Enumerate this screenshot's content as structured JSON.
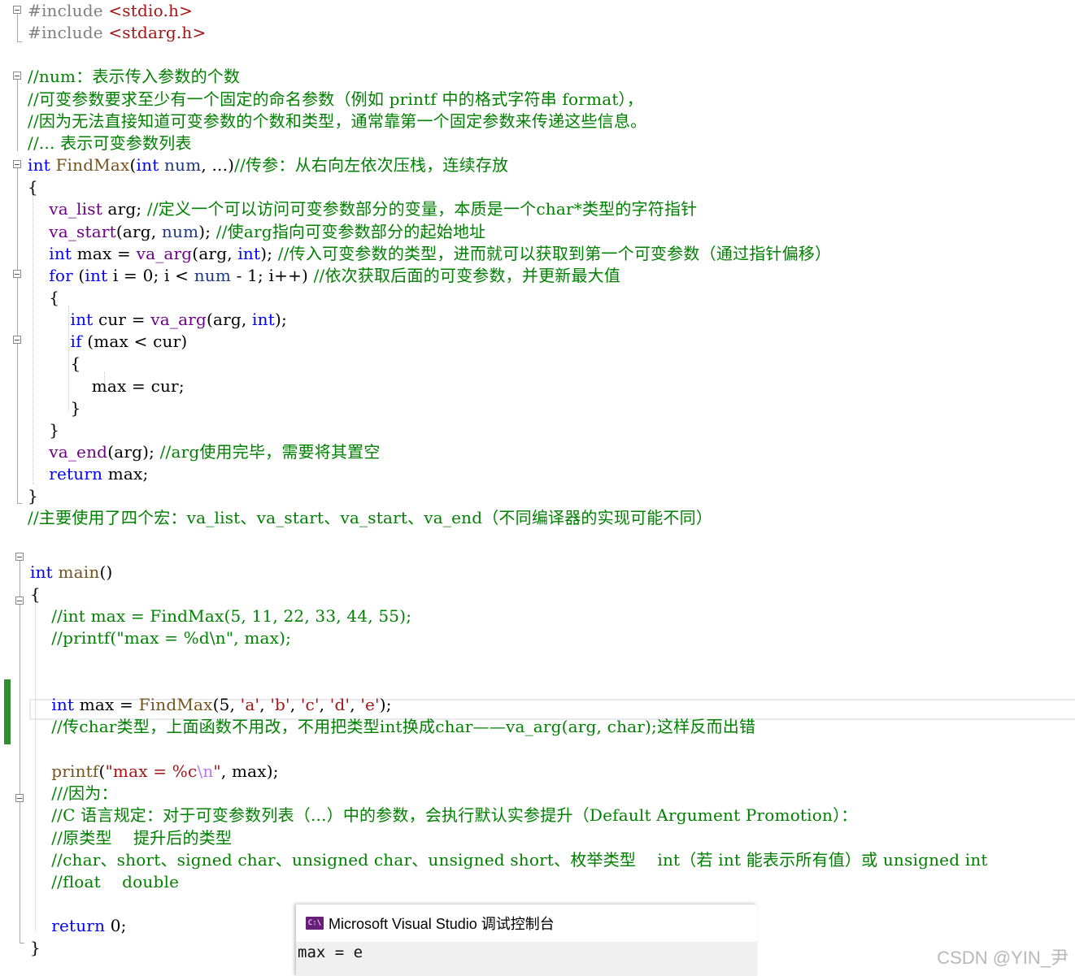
{
  "editor": {
    "lines": [
      {
        "tokens": [
          {
            "t": "#include ",
            "c": "pre"
          },
          {
            "t": "<stdio.h>",
            "c": "str"
          }
        ]
      },
      {
        "tokens": [
          {
            "t": "#include ",
            "c": "pre"
          },
          {
            "t": "<stdarg.h>",
            "c": "str"
          }
        ]
      },
      {
        "tokens": []
      },
      {
        "tokens": [
          {
            "t": "//num：表示传入参数的个数",
            "c": "cm"
          }
        ]
      },
      {
        "tokens": [
          {
            "t": "//可变参数要求至少有一个固定的命名参数（例如 printf 中的格式字符串 format），",
            "c": "cm"
          }
        ]
      },
      {
        "tokens": [
          {
            "t": "//因为无法直接知道可变参数的个数和类型，通常靠第一个固定参数来传递这些信息。",
            "c": "cm"
          }
        ]
      },
      {
        "tokens": [
          {
            "t": "//... 表示可变参数列表",
            "c": "cm"
          }
        ]
      },
      {
        "tokens": [
          {
            "t": "int",
            "c": "kw"
          },
          {
            "t": " ",
            "c": "pl"
          },
          {
            "t": "FindMax",
            "c": "fn"
          },
          {
            "t": "(",
            "c": "pl"
          },
          {
            "t": "int",
            "c": "kw"
          },
          {
            "t": " ",
            "c": "pl"
          },
          {
            "t": "num",
            "c": "var"
          },
          {
            "t": ", ...)",
            "c": "pl"
          },
          {
            "t": "//传参：从右向左依次压栈，连续存放",
            "c": "cm"
          }
        ]
      },
      {
        "tokens": [
          {
            "t": "{",
            "c": "pl"
          }
        ]
      },
      {
        "tokens": [
          {
            "t": "    ",
            "c": "pl"
          },
          {
            "t": "va_list",
            "c": "macro"
          },
          {
            "t": " ",
            "c": "pl"
          },
          {
            "t": "arg",
            "c": "id"
          },
          {
            "t": "; ",
            "c": "pl"
          },
          {
            "t": "//定义一个可以访问可变参数部分的变量，本质是一个char*类型的字符指针",
            "c": "cm"
          }
        ]
      },
      {
        "tokens": [
          {
            "t": "    ",
            "c": "pl"
          },
          {
            "t": "va_start",
            "c": "macro"
          },
          {
            "t": "(",
            "c": "pl"
          },
          {
            "t": "arg",
            "c": "id"
          },
          {
            "t": ", ",
            "c": "pl"
          },
          {
            "t": "num",
            "c": "var"
          },
          {
            "t": "); ",
            "c": "pl"
          },
          {
            "t": "//使arg指向可变参数部分的起始地址",
            "c": "cm"
          }
        ]
      },
      {
        "tokens": [
          {
            "t": "    ",
            "c": "pl"
          },
          {
            "t": "int",
            "c": "kw"
          },
          {
            "t": " ",
            "c": "pl"
          },
          {
            "t": "max",
            "c": "id"
          },
          {
            "t": " = ",
            "c": "pl"
          },
          {
            "t": "va_arg",
            "c": "macro"
          },
          {
            "t": "(",
            "c": "pl"
          },
          {
            "t": "arg",
            "c": "id"
          },
          {
            "t": ", ",
            "c": "pl"
          },
          {
            "t": "int",
            "c": "kw"
          },
          {
            "t": "); ",
            "c": "pl"
          },
          {
            "t": "//传入可变参数的类型，进而就可以获取到第一个可变参数（通过指针偏移）",
            "c": "cm"
          }
        ]
      },
      {
        "tokens": [
          {
            "t": "    ",
            "c": "pl"
          },
          {
            "t": "for",
            "c": "kw"
          },
          {
            "t": " (",
            "c": "pl"
          },
          {
            "t": "int",
            "c": "kw"
          },
          {
            "t": " ",
            "c": "pl"
          },
          {
            "t": "i",
            "c": "id"
          },
          {
            "t": " = 0; ",
            "c": "pl"
          },
          {
            "t": "i",
            "c": "id"
          },
          {
            "t": " < ",
            "c": "pl"
          },
          {
            "t": "num",
            "c": "var"
          },
          {
            "t": " - 1; ",
            "c": "pl"
          },
          {
            "t": "i",
            "c": "id"
          },
          {
            "t": "++) ",
            "c": "pl"
          },
          {
            "t": "//依次获取后面的可变参数，并更新最大值",
            "c": "cm"
          }
        ]
      },
      {
        "tokens": [
          {
            "t": "    {",
            "c": "pl"
          }
        ]
      },
      {
        "tokens": [
          {
            "t": "        ",
            "c": "pl"
          },
          {
            "t": "int",
            "c": "kw"
          },
          {
            "t": " ",
            "c": "pl"
          },
          {
            "t": "cur",
            "c": "id"
          },
          {
            "t": " = ",
            "c": "pl"
          },
          {
            "t": "va_arg",
            "c": "macro"
          },
          {
            "t": "(",
            "c": "pl"
          },
          {
            "t": "arg",
            "c": "id"
          },
          {
            "t": ", ",
            "c": "pl"
          },
          {
            "t": "int",
            "c": "kw"
          },
          {
            "t": ");",
            "c": "pl"
          }
        ]
      },
      {
        "tokens": [
          {
            "t": "        ",
            "c": "pl"
          },
          {
            "t": "if",
            "c": "kw"
          },
          {
            "t": " (",
            "c": "pl"
          },
          {
            "t": "max",
            "c": "id"
          },
          {
            "t": " < ",
            "c": "pl"
          },
          {
            "t": "cur",
            "c": "id"
          },
          {
            "t": ")",
            "c": "pl"
          }
        ]
      },
      {
        "tokens": [
          {
            "t": "        {",
            "c": "pl"
          }
        ]
      },
      {
        "tokens": [
          {
            "t": "            ",
            "c": "pl"
          },
          {
            "t": "max",
            "c": "id"
          },
          {
            "t": " = ",
            "c": "pl"
          },
          {
            "t": "cur",
            "c": "id"
          },
          {
            "t": ";",
            "c": "pl"
          }
        ]
      },
      {
        "tokens": [
          {
            "t": "        }",
            "c": "pl"
          }
        ]
      },
      {
        "tokens": [
          {
            "t": "    }",
            "c": "pl"
          }
        ]
      },
      {
        "tokens": [
          {
            "t": "    ",
            "c": "pl"
          },
          {
            "t": "va_end",
            "c": "macro"
          },
          {
            "t": "(",
            "c": "pl"
          },
          {
            "t": "arg",
            "c": "id"
          },
          {
            "t": "); ",
            "c": "pl"
          },
          {
            "t": "//arg使用完毕，需要将其置空",
            "c": "cm"
          }
        ]
      },
      {
        "tokens": [
          {
            "t": "    ",
            "c": "pl"
          },
          {
            "t": "return",
            "c": "kw"
          },
          {
            "t": " ",
            "c": "pl"
          },
          {
            "t": "max",
            "c": "id"
          },
          {
            "t": ";",
            "c": "pl"
          }
        ]
      },
      {
        "tokens": [
          {
            "t": "}",
            "c": "pl"
          }
        ]
      },
      {
        "tokens": [
          {
            "t": "//主要使用了四个宏：va_list、va_start、va_start、va_end（不同编译器的实现可能不同）",
            "c": "cm"
          }
        ]
      },
      {
        "tokens": []
      },
      {
        "tokens": [
          {
            "t": "int",
            "c": "kw"
          },
          {
            "t": " ",
            "c": "pl"
          },
          {
            "t": "main",
            "c": "fn"
          },
          {
            "t": "()",
            "c": "pl"
          }
        ]
      },
      {
        "tokens": [
          {
            "t": "{",
            "c": "pl"
          }
        ]
      },
      {
        "tokens": [
          {
            "t": "    ",
            "c": "pl"
          },
          {
            "t": "//int max = FindMax(5, 11, 22, 33, 44, 55);",
            "c": "cm"
          }
        ]
      },
      {
        "tokens": [
          {
            "t": "    ",
            "c": "pl"
          },
          {
            "t": "//printf(\"max = %d\\n\", max);",
            "c": "cm"
          }
        ]
      },
      {
        "tokens": []
      },
      {
        "tokens": []
      },
      {
        "tokens": [
          {
            "t": "    ",
            "c": "pl"
          },
          {
            "t": "int",
            "c": "kw"
          },
          {
            "t": " ",
            "c": "pl"
          },
          {
            "t": "max",
            "c": "id"
          },
          {
            "t": " = ",
            "c": "pl"
          },
          {
            "t": "FindMax",
            "c": "fn"
          },
          {
            "t": "(5, ",
            "c": "pl"
          },
          {
            "t": "'a'",
            "c": "ch"
          },
          {
            "t": ", ",
            "c": "pl"
          },
          {
            "t": "'b'",
            "c": "ch"
          },
          {
            "t": ", ",
            "c": "pl"
          },
          {
            "t": "'c'",
            "c": "ch"
          },
          {
            "t": ", ",
            "c": "pl"
          },
          {
            "t": "'d'",
            "c": "ch"
          },
          {
            "t": ", ",
            "c": "pl"
          },
          {
            "t": "'e'",
            "c": "ch"
          },
          {
            "t": ");",
            "c": "pl"
          }
        ]
      },
      {
        "tokens": [
          {
            "t": "    ",
            "c": "pl"
          },
          {
            "t": "//传char类型，上面函数不用改，不用把类型int换成char——va_arg(arg, char);这样反而出错",
            "c": "cm"
          }
        ]
      },
      {
        "tokens": []
      },
      {
        "tokens": [
          {
            "t": "    ",
            "c": "pl"
          },
          {
            "t": "printf",
            "c": "fn"
          },
          {
            "t": "(",
            "c": "pl"
          },
          {
            "t": "\"max = %c",
            "c": "str"
          },
          {
            "t": "\\n",
            "c": "esc"
          },
          {
            "t": "\"",
            "c": "str"
          },
          {
            "t": ", ",
            "c": "pl"
          },
          {
            "t": "max",
            "c": "id"
          },
          {
            "t": ");",
            "c": "pl"
          }
        ]
      },
      {
        "tokens": [
          {
            "t": "    ",
            "c": "pl"
          },
          {
            "t": "///因为：",
            "c": "cm"
          }
        ]
      },
      {
        "tokens": [
          {
            "t": "    ",
            "c": "pl"
          },
          {
            "t": "//C 语言规定：对于可变参数列表（...）中的参数，会执行默认实参提升（Default Argument Promotion）：",
            "c": "cm"
          }
        ]
      },
      {
        "tokens": [
          {
            "t": "    ",
            "c": "pl"
          },
          {
            "t": "//原类型    提升后的类型",
            "c": "cm"
          }
        ]
      },
      {
        "tokens": [
          {
            "t": "    ",
            "c": "pl"
          },
          {
            "t": "//char、short、signed char、unsigned char、unsigned short、枚举类型    int（若 int 能表示所有值）或 unsigned int",
            "c": "cm"
          }
        ]
      },
      {
        "tokens": [
          {
            "t": "    ",
            "c": "pl"
          },
          {
            "t": "//float    double",
            "c": "cm"
          }
        ]
      },
      {
        "tokens": []
      },
      {
        "tokens": [
          {
            "t": "    ",
            "c": "pl"
          },
          {
            "t": "return",
            "c": "kw"
          },
          {
            "t": " 0;",
            "c": "pl"
          }
        ]
      },
      {
        "tokens": [
          {
            "t": "}",
            "c": "pl"
          }
        ]
      }
    ]
  },
  "console": {
    "icon": "console-app-icon",
    "icon_text": "C:\\",
    "title": "Microsoft Visual Studio 调试控制台",
    "output": "max = e"
  },
  "watermark": "CSDN @YIN_尹",
  "colors": {
    "keyword": "#0000ff",
    "comment": "#008000",
    "preprocessor": "#808080",
    "string": "#a31515",
    "macro": "#6f008a",
    "change_bar": "#2f8f2f"
  }
}
